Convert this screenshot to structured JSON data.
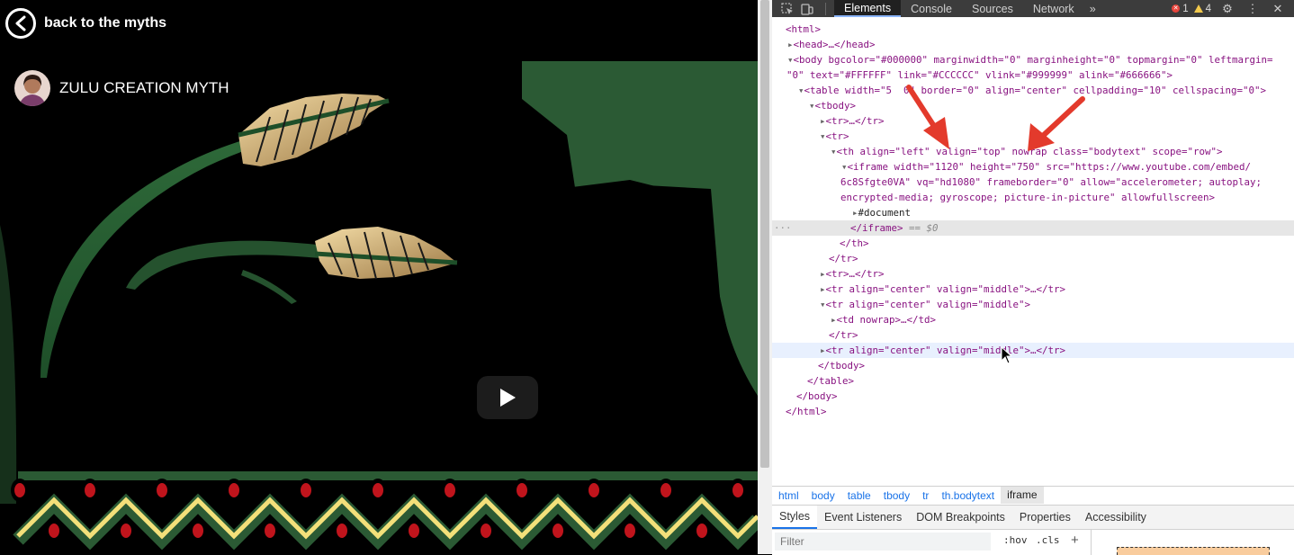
{
  "page": {
    "back_label": "back to the myths",
    "video_title": "ZULU CREATION MYTH"
  },
  "devtools": {
    "tabs": [
      "Elements",
      "Console",
      "Sources",
      "Network"
    ],
    "active_tab": "Elements",
    "more_tabs": "»",
    "errors": "1",
    "warnings": "4",
    "breadcrumbs": [
      "html",
      "body",
      "table",
      "tbody",
      "tr",
      "th.bodytext",
      "iframe"
    ],
    "active_breadcrumb": "iframe",
    "subtabs": [
      "Styles",
      "Event Listeners",
      "DOM Breakpoints",
      "Properties",
      "Accessibility"
    ],
    "active_subtab": "Styles",
    "filter_placeholder": "Filter",
    "hov_label": ":hov",
    "cls_label": ".cls",
    "plus_label": "+",
    "eq_label": "== $0",
    "lines": [
      "<html>",
      "<head>…</head>",
      "<body bgcolor=\"#000000\" marginwidth=\"0\" marginheight=\"0\" topmargin=\"0\" leftmargin=",
      "\"0\" text=\"#FFFFFF\" link=\"#CCCCCC\" vlink=\"#999999\" alink=\"#666666\">",
      "<table width=\"5  0\" border=\"0\" align=\"center\" cellpadding=\"10\" cellspacing=\"0\">",
      "<tbody>",
      "<tr>…</tr>",
      "<tr>",
      "<th align=\"left\" valign=\"top\" nowrap class=\"bodytext\" scope=\"row\">",
      "<iframe width=\"1120\" height=\"750\" src=\"https://www.youtube.com/embed/",
      "6c8Sfgte0VA\" vq=\"hd1080\" frameborder=\"0\" allow=\"accelerometer; autoplay;",
      "encrypted-media; gyroscope; picture-in-picture\" allowfullscreen>",
      "#document",
      "</iframe>",
      "</th>",
      "</tr>",
      "<tr>…</tr>",
      "<tr align=\"center\" valign=\"middle\">…</tr>",
      "<tr align=\"center\" valign=\"middle\">",
      "<td nowrap>…</td>",
      "</tr>",
      "<tr align=\"center\" valign=\"middle\">…</tr>",
      "</tbody>",
      "</table>",
      "</body>",
      "</html>"
    ]
  },
  "colors": {
    "page_bg": "#000000",
    "art_green": "#2b5a34",
    "art_gold": "#d9b477",
    "border_red": "#c0141c",
    "border_yellow": "#f3e07a",
    "annotation_arrow": "#e33a2c",
    "devtools_toolbar": "#3c3c3c"
  }
}
